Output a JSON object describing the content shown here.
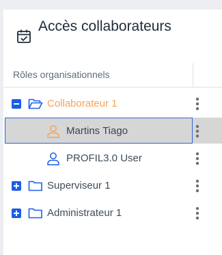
{
  "header": {
    "title": "Accès collaborateurs",
    "icon": "calendar-check-icon"
  },
  "table": {
    "column_header": "Rôles organisationnels"
  },
  "tree": {
    "items": [
      {
        "label": "Collaborateur 1",
        "level": 0,
        "expanded": true,
        "type": "folder",
        "highlight": true
      },
      {
        "label": "Martins Tiago",
        "level": 1,
        "type": "user",
        "selected": true
      },
      {
        "label": "PROFIL3.0 User",
        "level": 1,
        "type": "user"
      },
      {
        "label": "Superviseur 1",
        "level": 0,
        "expanded": false,
        "type": "folder"
      },
      {
        "label": "Administrateur 1",
        "level": 0,
        "expanded": false,
        "type": "folder"
      }
    ]
  },
  "colors": {
    "accent_blue": "#1a5ee8",
    "highlight_orange": "#f4a25a",
    "text": "#3f4b58"
  }
}
